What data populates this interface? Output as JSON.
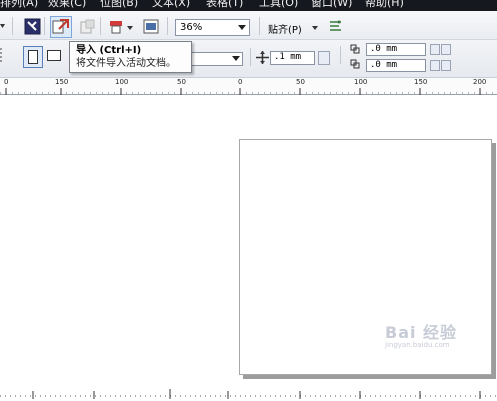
{
  "menubar": {
    "items": [
      "排列(A)",
      "效果(C)",
      "位图(B)",
      "文本(X)",
      "表格(T)",
      "工具(O)",
      "窗口(W)",
      "帮助(H)"
    ]
  },
  "toolbar": {
    "zoom_value": "36%",
    "snap_label": "贴齐(P)"
  },
  "propbar": {
    "nudge_value": ".1 mm",
    "dup_x_value": ".0 mm",
    "dup_y_value": ".0 mm"
  },
  "tooltip": {
    "title": "导入 (Ctrl+I)",
    "description": "将文件导入活动文档。"
  },
  "ruler": {
    "labels": [
      "0",
      "150",
      "100",
      "50",
      "0",
      "50",
      "100",
      "150",
      "200"
    ]
  },
  "watermark": {
    "text": "Bai 经验",
    "sub": "jingyan.baidu.com"
  },
  "colors": {
    "menubar_bg": "#16181f",
    "toolbar_bg": "#eef0f4",
    "page_shadow": "#9c9c9c"
  }
}
